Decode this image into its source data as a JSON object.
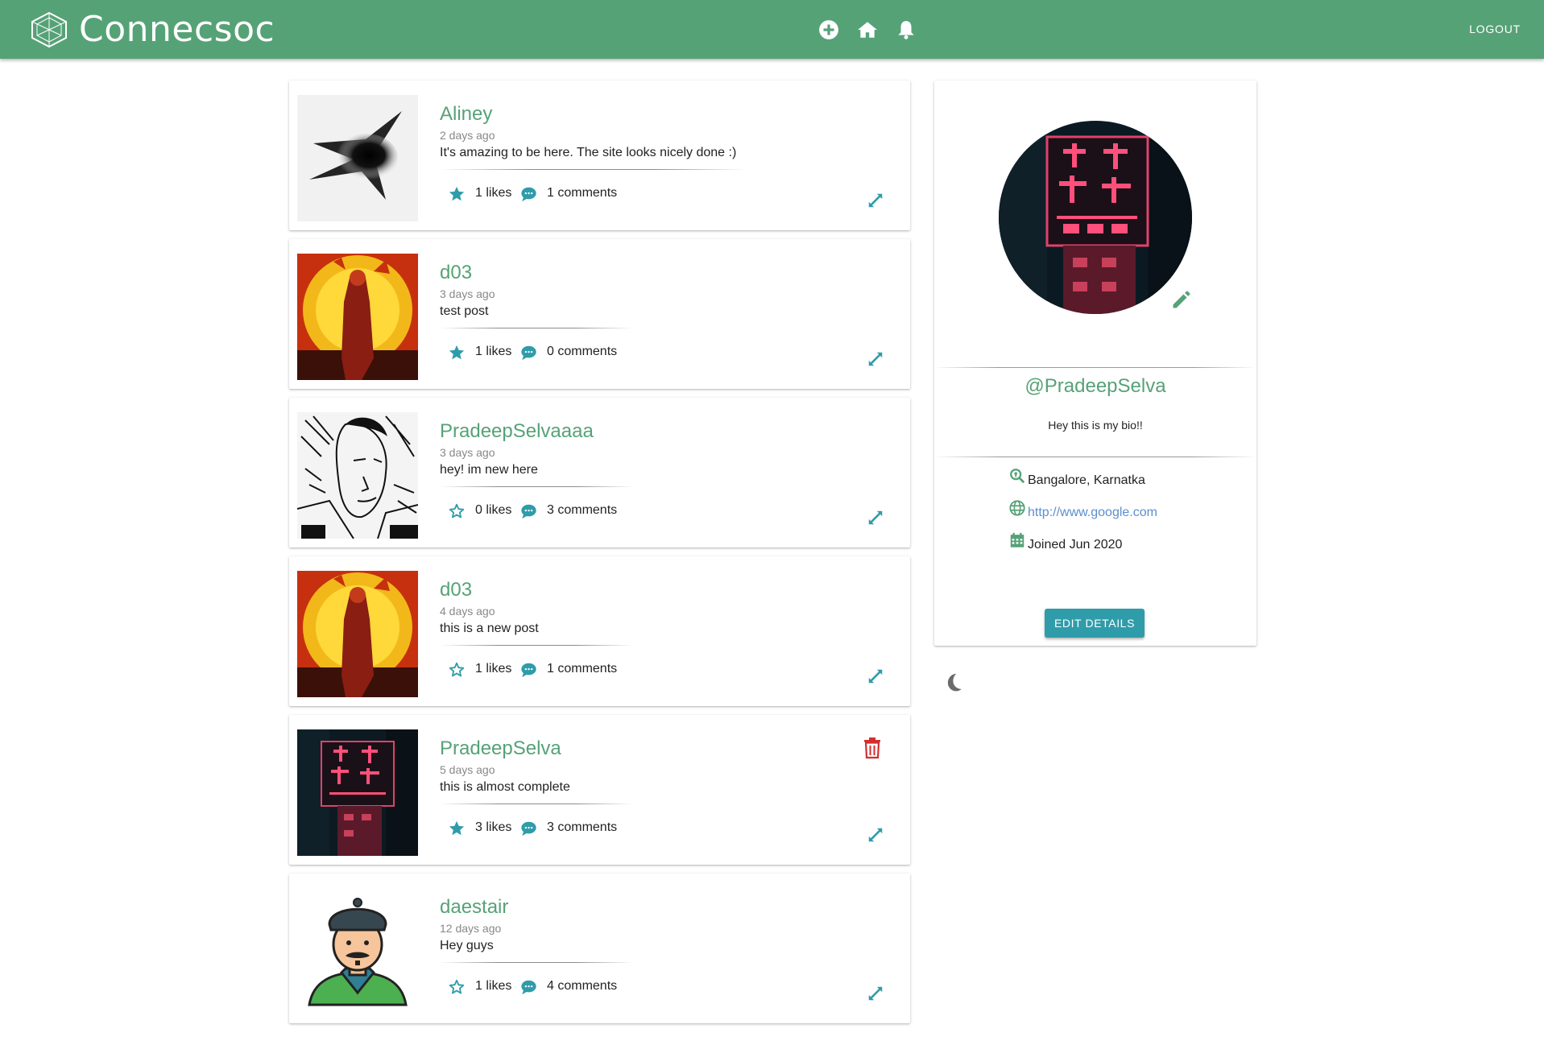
{
  "app": {
    "brand": "Connecsoc",
    "logout_label": "LOGOUT",
    "icons": [
      "logo-icon",
      "add-circle-icon",
      "home-icon",
      "bell-icon"
    ],
    "colors": {
      "primary": "#56a277",
      "accent": "#2f9caa",
      "danger": "#d32f2f",
      "link": "#5b8fcf"
    }
  },
  "posts": [
    {
      "username": "Aliney",
      "time": "2 days ago",
      "text": "It's amazing to be here. The site looks nicely done :)",
      "likes": "1 likes",
      "comments": "1 comments",
      "liked": true,
      "deletable": false
    },
    {
      "username": "d03",
      "time": "3 days ago",
      "text": "test post",
      "likes": "1 likes",
      "comments": "0 comments",
      "liked": true,
      "deletable": false
    },
    {
      "username": "PradeepSelvaaaa",
      "time": "3 days ago",
      "text": "hey! im new here",
      "likes": "0 likes",
      "comments": "3 comments",
      "liked": false,
      "deletable": false
    },
    {
      "username": "d03",
      "time": "4 days ago",
      "text": "this is a new post",
      "likes": "1 likes",
      "comments": "1 comments",
      "liked": false,
      "deletable": false
    },
    {
      "username": "PradeepSelva",
      "time": "5 days ago",
      "text": "this is almost complete",
      "likes": "3 likes",
      "comments": "3 comments",
      "liked": true,
      "deletable": true
    },
    {
      "username": "daestair",
      "time": "12 days ago",
      "text": "Hey guys",
      "likes": "1 likes",
      "comments": "4 comments",
      "liked": false,
      "deletable": false
    }
  ],
  "profile": {
    "handle": "@PradeepSelva",
    "bio": "Hey this is my bio!!",
    "location": "Bangalore, Karnatka",
    "website": "http://www.google.com",
    "joined": "Joined Jun 2020",
    "edit_label": "EDIT DETAILS"
  }
}
